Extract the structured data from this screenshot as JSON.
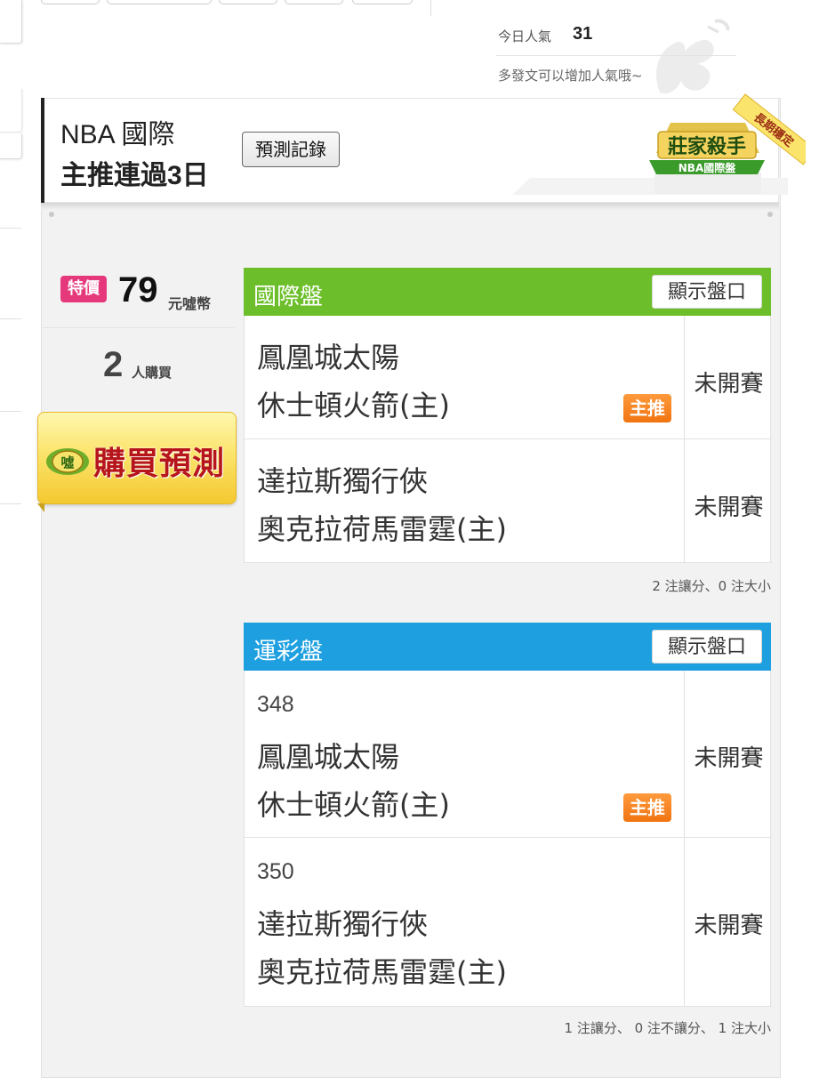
{
  "popularity": {
    "label": "今日人氣",
    "value": "31",
    "hint": "多發文可以增加人氣哦~"
  },
  "header": {
    "line1": "NBA 國際",
    "line2": "主推連過3日",
    "record_button": "預測記錄",
    "badge_title": "莊家殺手",
    "badge_subtitle": "NBA國際盤",
    "ribbon_text": "長期穩定"
  },
  "pricing": {
    "tag": "特價",
    "value": "79",
    "unit": "元噓幣",
    "buyers": "2",
    "buyers_label": "人購買",
    "buy_button": "購買預測",
    "coin_glyph": "噓"
  },
  "intl_table": {
    "title": "國際盤",
    "show_button": "顯示盤口",
    "rows": [
      {
        "team1": "鳳凰城太陽",
        "team2": "休士頓火箭(主)",
        "tag": "主推",
        "status": "未開賽"
      },
      {
        "team1": "達拉斯獨行俠",
        "team2": "奧克拉荷馬雷霆(主)",
        "status": "未開賽"
      }
    ],
    "summary": "2 注讓分、0 注大小"
  },
  "lottery_table": {
    "title": "運彩盤",
    "show_button": "顯示盤口",
    "rows": [
      {
        "code": "348",
        "team1": "鳳凰城太陽",
        "team2": "休士頓火箭(主)",
        "tag": "主推",
        "status": "未開賽"
      },
      {
        "code": "350",
        "team1": "達拉斯獨行俠",
        "team2": "奧克拉荷馬雷霆(主)",
        "status": "未開賽"
      }
    ],
    "summary": "1 注讓分、 0 注不讓分、 1 注大小"
  },
  "colors": {
    "intl_header": "#6cbf2a",
    "lottery_header": "#1ea0e0",
    "price_tag": "#e6397c",
    "main_tag": "#f07410",
    "buy_button_text": "#b6161b"
  }
}
